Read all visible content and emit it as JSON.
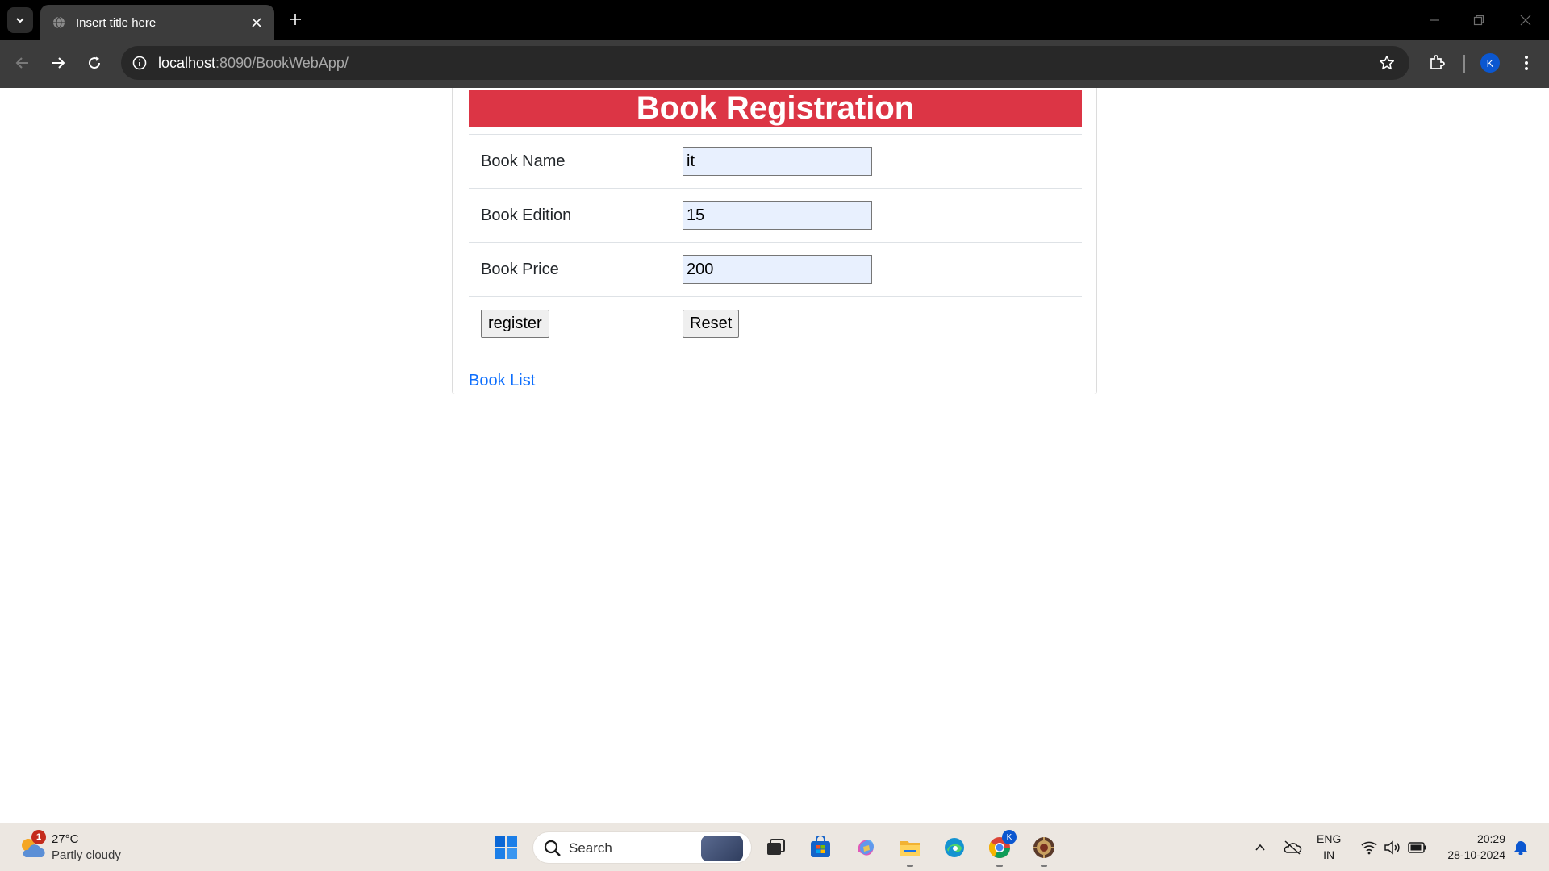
{
  "browser": {
    "tab_title": "Insert title here",
    "url_host": "localhost",
    "url_rest": ":8090/BookWebApp/",
    "profile_initial": "K"
  },
  "form": {
    "heading": "Book Registration",
    "book_name": {
      "label": "Book Name",
      "value": "it"
    },
    "book_edition": {
      "label": "Book Edition",
      "value": "15"
    },
    "book_price": {
      "label": "Book Price",
      "value": "200"
    },
    "register_label": "register",
    "reset_label": "Reset",
    "book_list_link": "Book List"
  },
  "taskbar": {
    "weather_badge": "1",
    "weather_temp": "27°C",
    "weather_desc": "Partly cloudy",
    "search_label": "Search",
    "chrome_badge": "K",
    "lang_line1": "ENG",
    "lang_line2": "IN",
    "time": "20:29",
    "date": "28-10-2024"
  },
  "colors": {
    "heading_bg": "#dc3545",
    "link": "#0d6efd",
    "input_bg": "#e8f0fe"
  }
}
